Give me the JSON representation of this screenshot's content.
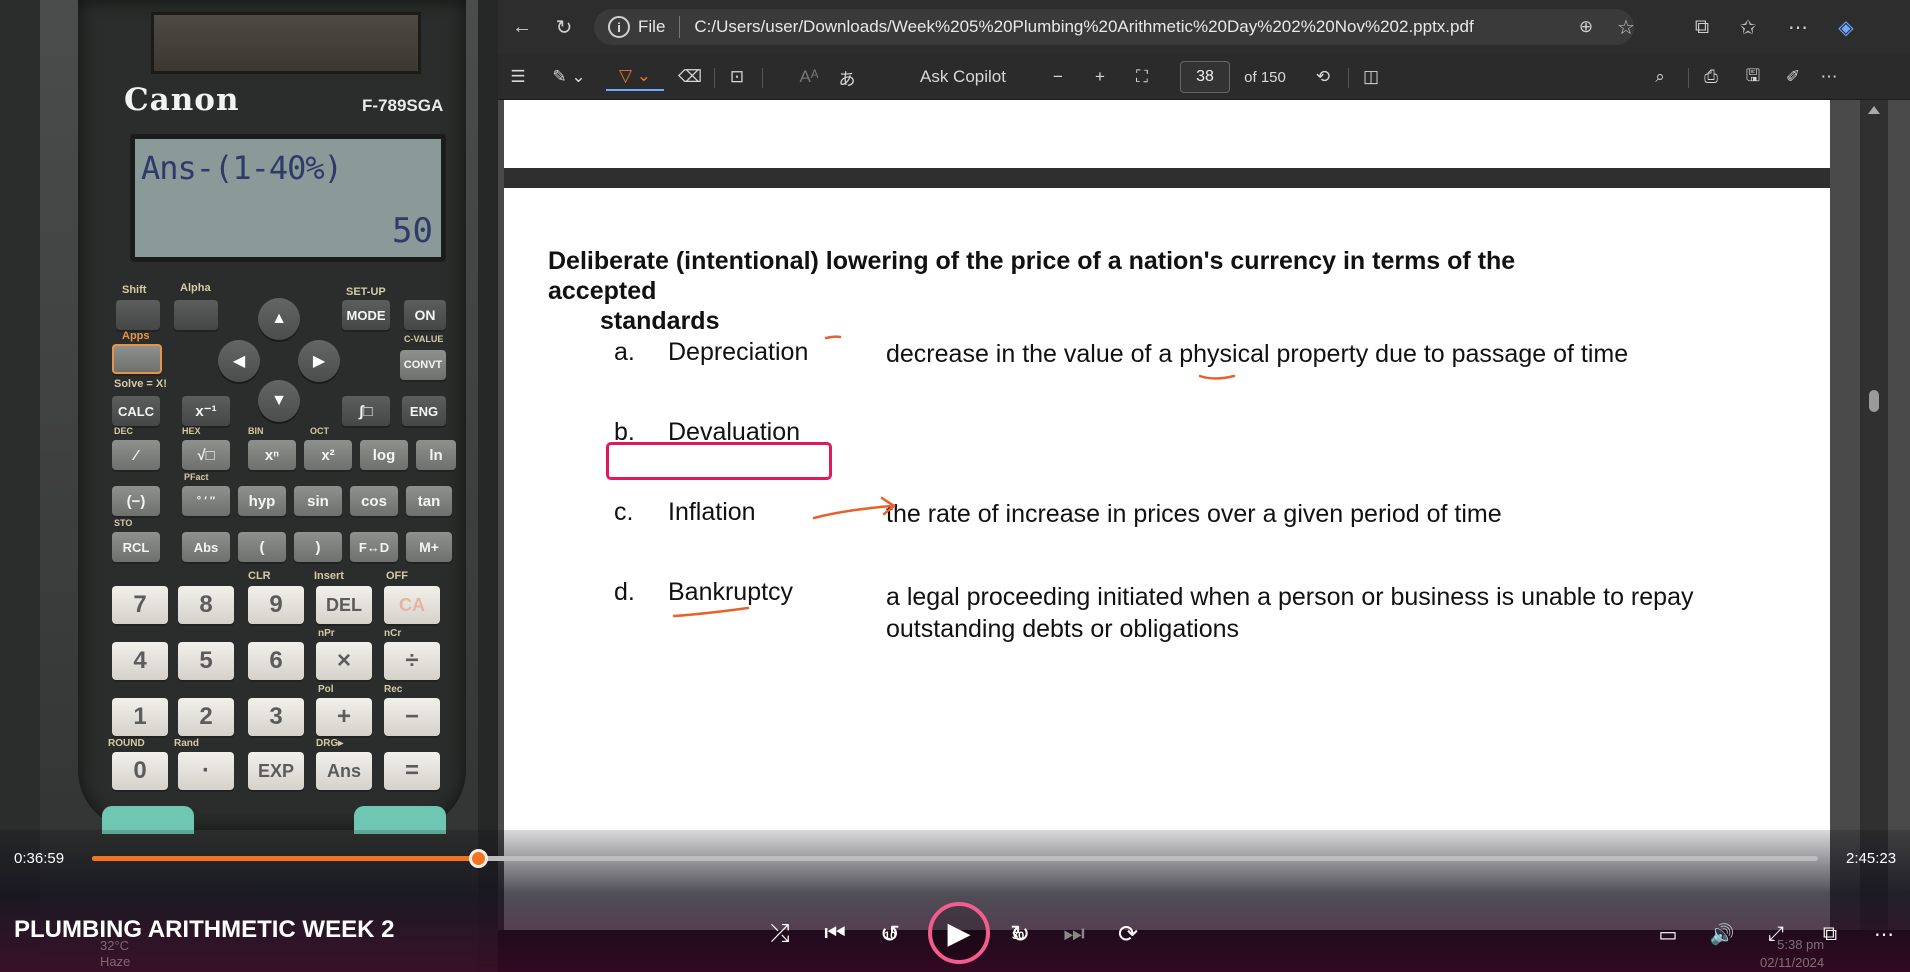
{
  "calculator": {
    "brand": "Canon",
    "model": "F-789SGA",
    "display_expression": "Ans-(1-40%)",
    "display_result": "50",
    "labels": {
      "shift": "Shift",
      "alpha": "Alpha",
      "setup": "SET-UP",
      "mode": "MODE",
      "on": "ON",
      "apps": "Apps",
      "cvalue": "C-VALUE",
      "convt": "CONVT",
      "solve": "Solve = X!",
      "calc": "CALC",
      "eng": "ENG",
      "dec": "DEC",
      "hex": "HEX",
      "bin": "BIN",
      "oct": "OCT",
      "log": "log",
      "ln": "ln",
      "pfact": "PFact",
      "hyp": "hyp",
      "sin": "sin",
      "cos": "cos",
      "tan": "tan",
      "sto": "STO",
      "rcl": "RCL",
      "abs": "Abs",
      "fd": "F↔D",
      "mplus": "M+",
      "clr": "CLR",
      "insert": "Insert",
      "off": "OFF",
      "del": "DEL",
      "ca": "CA",
      "npr": "nPr",
      "ncr": "nCr",
      "pol": "Pol",
      "rec": "Rec",
      "round": "ROUND",
      "rand": "Rand",
      "drg": "DRG▸",
      "exp": "EXP",
      "ans": "Ans"
    }
  },
  "browser": {
    "address": "C:/Users/user/Downloads/Week%205%20Plumbing%20Arithmetic%20Day%202%20Nov%202.pptx.pdf",
    "address_prefix": "File",
    "toolbar": {
      "ask_copilot": "Ask Copilot",
      "page_current": "38",
      "page_total": "of 150"
    }
  },
  "slide": {
    "question_line1": "Deliberate (intentional) lowering of the price of a nation's currency in terms of the accepted",
    "question_line2": "standards",
    "options": [
      {
        "letter": "a.",
        "term": "Depreciation",
        "desc": "decrease in the value of a physical property due to passage of time"
      },
      {
        "letter": "b.",
        "term": "Devaluation",
        "desc": ""
      },
      {
        "letter": "c.",
        "term": "Inflation",
        "desc": "the rate of increase in prices over a given period of time"
      },
      {
        "letter": "d.",
        "term": "Bankruptcy",
        "desc_line1": "a legal proceeding initiated when a person or business is unable to repay",
        "desc_line2": "outstanding debts or obligations"
      }
    ],
    "annotation_color": "#e8612a",
    "highlight_color": "#e0185c"
  },
  "player": {
    "current_time": "0:36:59",
    "total_time": "2:45:23",
    "progress_fraction": 0.224,
    "title": "PLUMBING ARITHMETIC WEEK 2",
    "skip_back": "10",
    "skip_forward": "30",
    "accent": "#f27420"
  },
  "taskbar": {
    "temp": "32°C",
    "weather": "Haze",
    "time": "5:38 pm",
    "date": "02/11/2024"
  }
}
